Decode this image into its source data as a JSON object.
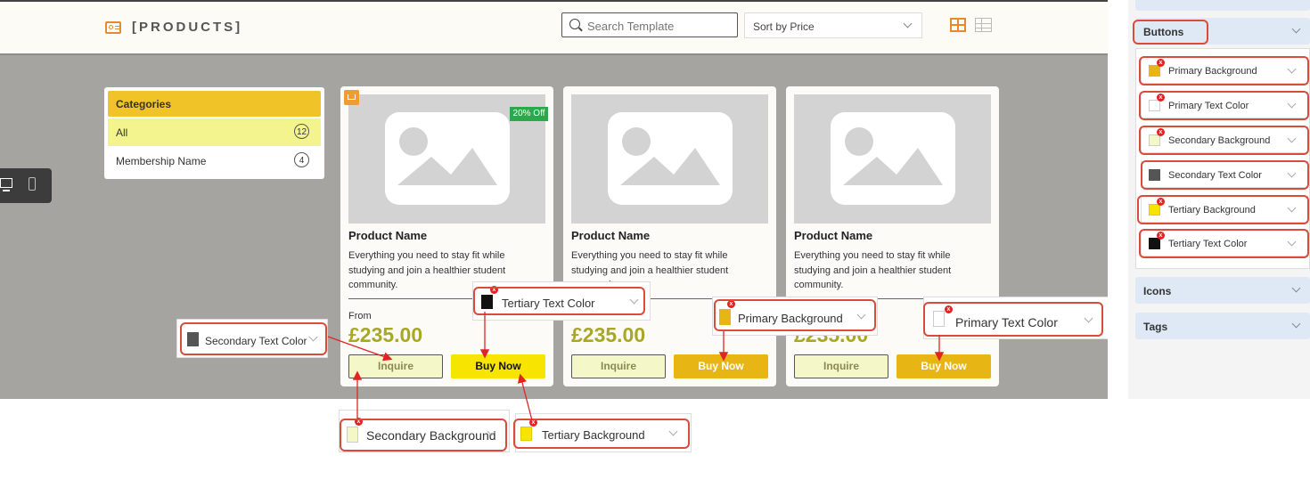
{
  "header": {
    "title": "[PRODUCTS]",
    "search_placeholder": "Search Template",
    "sort_label": "Sort by Price"
  },
  "categories": {
    "title": "Categories",
    "items": [
      {
        "label": "All",
        "count": "12"
      },
      {
        "label": "Membership Name",
        "count": "4"
      }
    ]
  },
  "products": [
    {
      "name": "Product Name",
      "description": "Everything you need to stay fit while studying and join a healthier student community.",
      "from_label": "From",
      "price": "£235.00",
      "inquire_label": "Inquire",
      "buy_label": "Buy Now",
      "badge": "20% Off"
    },
    {
      "name": "Product Name",
      "description": "Everything you need to stay fit while studying and join a healthier student community.",
      "price": "£235.00",
      "inquire_label": "Inquire",
      "buy_label": "Buy Now"
    },
    {
      "name": "Product Name",
      "description": "Everything you need to stay fit while studying and join a healthier student community.",
      "price": "£235.00",
      "inquire_label": "Inquire",
      "buy_label": "Buy Now"
    }
  ],
  "right_panel": {
    "sections": [
      {
        "label": "Buttons"
      },
      {
        "label": "Icons"
      },
      {
        "label": "Tags"
      }
    ],
    "pickers": [
      {
        "label": "Primary Background",
        "color": "#e8b614"
      },
      {
        "label": "Primary Text Color",
        "color": "#ffffff"
      },
      {
        "label": "Secondary Background",
        "color": "#f4f7c8"
      },
      {
        "label": "Secondary Text Color",
        "color": "#555555"
      },
      {
        "label": "Tertiary Background",
        "color": "#f7e400"
      },
      {
        "label": "Tertiary Text Color",
        "color": "#111111"
      }
    ]
  },
  "callouts": {
    "secondary_text_color": "Secondary Text Color",
    "tertiary_text_color": "Tertiary Text Color",
    "primary_background": "Primary Background",
    "primary_text_color": "Primary Text Color",
    "secondary_background": "Secondary Background",
    "tertiary_background": "Tertiary Background"
  },
  "colors": {
    "accent_orange": "#e58a2e",
    "highlight_red": "#d94b3a",
    "gold": "#e8b614",
    "tertiary_yellow": "#f7e400"
  },
  "icons": [
    "id-card-icon",
    "search-icon",
    "chevron-down-icon",
    "grid-view-icon",
    "list-view-icon",
    "desktop-icon",
    "mobile-icon",
    "image-placeholder-icon",
    "crown-icon",
    "remove-x-icon"
  ]
}
